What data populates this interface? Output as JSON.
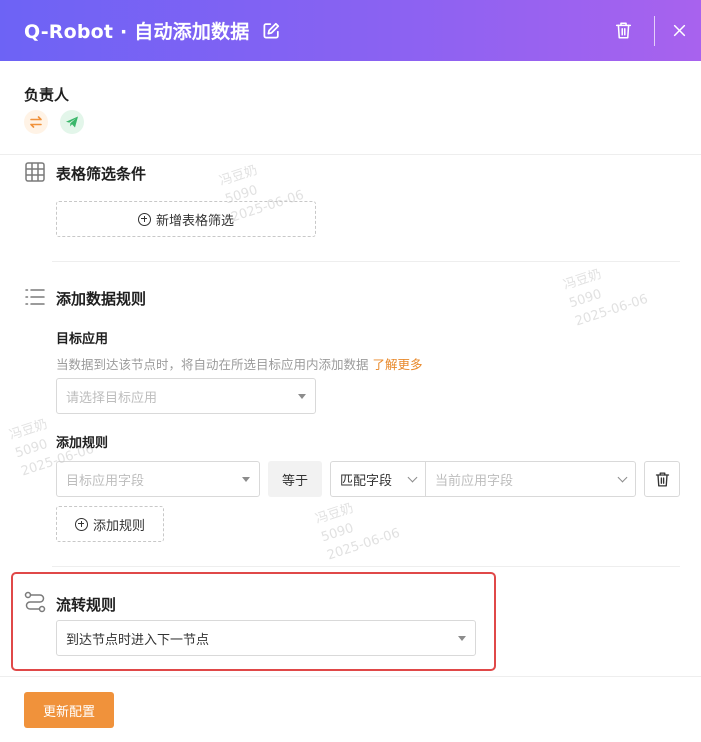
{
  "header": {
    "title": "Q-Robot · 自动添加数据"
  },
  "owner": {
    "label": "负责人"
  },
  "table_filter": {
    "title": "表格筛选条件",
    "add_button": "新增表格筛选"
  },
  "add_rule": {
    "title": "添加数据规则",
    "target_app": {
      "label": "目标应用",
      "hint": "当数据到达该节点时，将自动在所选目标应用内添加数据",
      "link": "了解更多",
      "placeholder": "请选择目标应用"
    },
    "rules": {
      "label": "添加规则",
      "target_field_placeholder": "目标应用字段",
      "operator": "等于",
      "match_type": "匹配字段",
      "current_field_placeholder": "当前应用字段",
      "add_button": "添加规则"
    }
  },
  "flow_rule": {
    "title": "流转规则",
    "value": "到达节点时进入下一节点"
  },
  "footer": {
    "submit_label": "更新配置"
  },
  "watermark": {
    "name": "冯豆奶",
    "id": "5090",
    "date": "2025-06-06"
  },
  "colors": {
    "header_start": "#6d63f5",
    "header_end": "#a862ee",
    "accent": "#f0923b",
    "link": "#e8892b",
    "highlight_border": "#e04848"
  }
}
